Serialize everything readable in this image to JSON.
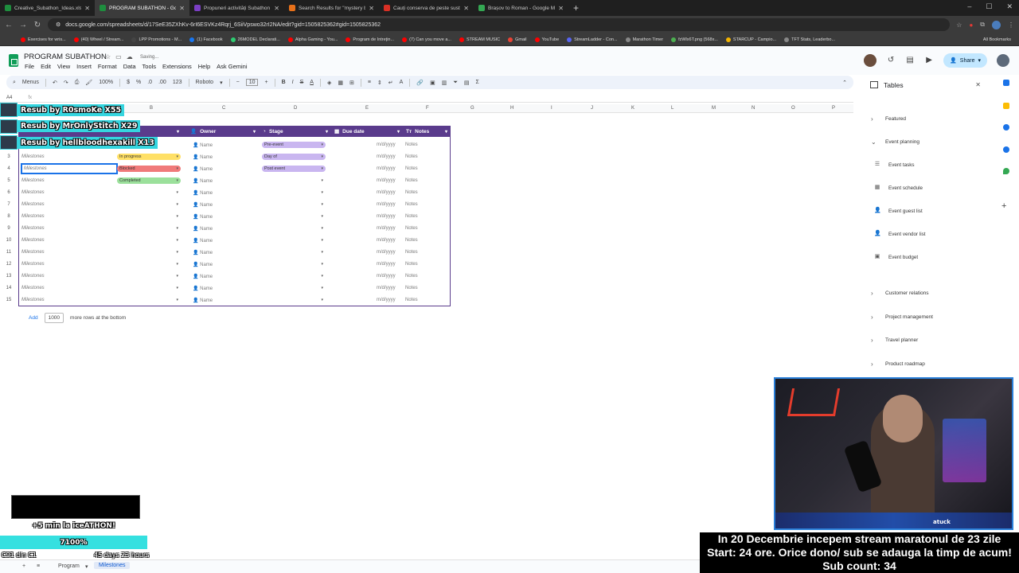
{
  "browser": {
    "tabs": [
      {
        "title": "Creative_Subathon_Ideas.xlsx",
        "color": "#1e8e3e"
      },
      {
        "title": "PROGRAM SUBATHON - Google",
        "color": "#1e8e3e",
        "active": true
      },
      {
        "title": "Propuneri activități Subathon (",
        "color": "#7b3fc4"
      },
      {
        "title": "Search Results for \"mystery b",
        "color": "#e8711a"
      },
      {
        "title": "Cauți conserva de peste sustro",
        "color": "#d93025"
      },
      {
        "title": "Brașov to Roman - Google Ma",
        "color": "#34a853"
      }
    ],
    "url": "docs.google.com/spreadsheets/d/17SeE35ZXhKv-6rI6ESVKz4Rqrj_6SiiVpswo32rI2NA/edit?gid=1505825362#gid=1505825362",
    "bookmarks": [
      {
        "label": "Exercises for wris...",
        "color": "#ff0000"
      },
      {
        "label": "(40) Wheel / Stream...",
        "color": "#ff0000"
      },
      {
        "label": "LPP Promotions - M...",
        "color": "#444444"
      },
      {
        "label": "(1) Facebook",
        "color": "#1877f2"
      },
      {
        "label": "26MODEL Declarati...",
        "color": "#2ecc71"
      },
      {
        "label": "Alpha Gaming - You...",
        "color": "#ff0000"
      },
      {
        "label": "Program de Intreţin...",
        "color": "#ff0000"
      },
      {
        "label": "(7) Can you move a...",
        "color": "#ff0000"
      },
      {
        "label": "STREAM MUSIC",
        "color": "#ff0000"
      },
      {
        "label": "Gmail",
        "color": "#ea4335"
      },
      {
        "label": "YouTube",
        "color": "#ff0000"
      },
      {
        "label": "StreamLadder - Con...",
        "color": "#5865f2"
      },
      {
        "label": "Marathon Timer",
        "color": "#888888"
      },
      {
        "label": "fzWlx6T.png (568x...",
        "color": "#4caf50"
      },
      {
        "label": "STARCUP - Campio...",
        "color": "#f4b400"
      },
      {
        "label": "TFT Stats, Leaderbo...",
        "color": "#888888"
      }
    ],
    "all_bookmarks": "All Bookmarks"
  },
  "sheets": {
    "title": "PROGRAM SUBATHON",
    "status": "Saving...",
    "menu": [
      "File",
      "Edit",
      "View",
      "Insert",
      "Format",
      "Data",
      "Tools",
      "Extensions",
      "Help",
      "Ask Gemini"
    ],
    "share": "Share",
    "toolbar": {
      "menus": "Menus",
      "zoom": "100%",
      "currency": "$",
      "percent": "%",
      "dec_less": ".0",
      "dec_more": ".00",
      "numfmt": "123",
      "font": "Roboto",
      "size": "10"
    },
    "cell_ref": "A4",
    "fx": "fx",
    "columns": [
      "A",
      "B",
      "C",
      "D",
      "E",
      "F",
      "G",
      "H",
      "I",
      "J",
      "K",
      "L",
      "M",
      "N",
      "O",
      "P"
    ],
    "table_headers": {
      "owner": "Owner",
      "stage": "Stage",
      "due": "Due date",
      "notes": "Notes"
    },
    "rows": [
      {
        "num": "3",
        "task": "Milestones",
        "status": "In progress",
        "status_color": "#ffe066",
        "owner": "Name",
        "stage": "Day of",
        "stage_color": "#c9b6f0",
        "due": "m/d/yyyy",
        "notes": "Notes"
      },
      {
        "num": "4",
        "task": "Milestones",
        "status": "Blocked",
        "status_color": "#f07a7a",
        "owner": "Name",
        "stage": "Post event",
        "stage_color": "#c9b6f0",
        "due": "m/d/yyyy",
        "notes": "Notes"
      },
      {
        "num": "5",
        "task": "Milestones",
        "status": "Completed",
        "status_color": "#9be09b",
        "owner": "Name",
        "stage": "",
        "stage_color": "",
        "due": "m/d/yyyy",
        "notes": "Notes"
      },
      {
        "num": "6",
        "task": "Milestones",
        "status": "",
        "status_color": "",
        "owner": "Name",
        "stage": "",
        "stage_color": "",
        "due": "m/d/yyyy",
        "notes": "Notes"
      },
      {
        "num": "7",
        "task": "Milestones",
        "status": "",
        "status_color": "",
        "owner": "Name",
        "stage": "",
        "stage_color": "",
        "due": "m/d/yyyy",
        "notes": "Notes"
      },
      {
        "num": "8",
        "task": "Milestones",
        "status": "",
        "status_color": "",
        "owner": "Name",
        "stage": "",
        "stage_color": "",
        "due": "m/d/yyyy",
        "notes": "Notes"
      },
      {
        "num": "9",
        "task": "Milestones",
        "status": "",
        "status_color": "",
        "owner": "Name",
        "stage": "",
        "stage_color": "",
        "due": "m/d/yyyy",
        "notes": "Notes"
      },
      {
        "num": "10",
        "task": "Milestones",
        "status": "",
        "status_color": "",
        "owner": "Name",
        "stage": "",
        "stage_color": "",
        "due": "m/d/yyyy",
        "notes": "Notes"
      },
      {
        "num": "11",
        "task": "Milestones",
        "status": "",
        "status_color": "",
        "owner": "Name",
        "stage": "",
        "stage_color": "",
        "due": "m/d/yyyy",
        "notes": "Notes"
      },
      {
        "num": "12",
        "task": "Milestones",
        "status": "",
        "status_color": "",
        "owner": "Name",
        "stage": "",
        "stage_color": "",
        "due": "m/d/yyyy",
        "notes": "Notes"
      },
      {
        "num": "13",
        "task": "Milestones",
        "status": "",
        "status_color": "",
        "owner": "Name",
        "stage": "",
        "stage_color": "",
        "due": "m/d/yyyy",
        "notes": "Notes"
      },
      {
        "num": "14",
        "task": "Milestones",
        "status": "",
        "status_color": "",
        "owner": "Name",
        "stage": "",
        "stage_color": "",
        "due": "m/d/yyyy",
        "notes": "Notes"
      },
      {
        "num": "15",
        "task": "Milestones",
        "status": "",
        "status_color": "",
        "owner": "Name",
        "stage": "",
        "stage_color": "",
        "due": "m/d/yyyy",
        "notes": "Notes"
      }
    ],
    "top_stage_chip": "Pre-event",
    "top_owner": "Name",
    "top_due": "m/d/yyyy",
    "top_notes": "Notes",
    "add_label": "Add",
    "add_count": "1000",
    "add_suffix": "more rows at the bottom",
    "sheet_tabs": [
      "Program",
      "Milestones"
    ],
    "accent": "#5a3b8c"
  },
  "side_panel": {
    "title": "Tables",
    "sections": [
      "Featured",
      "Event planning",
      "Customer relations",
      "Project management",
      "Travel planner",
      "Product roadmap"
    ],
    "event_items": [
      {
        "label": "Event tasks",
        "icon": "checklist-icon"
      },
      {
        "label": "Event schedule",
        "icon": "calendar-icon"
      },
      {
        "label": "Event guest list",
        "icon": "person-icon"
      },
      {
        "label": "Event vendor list",
        "icon": "person-icon"
      },
      {
        "label": "Event budget",
        "icon": "money-icon"
      }
    ]
  },
  "overlay": {
    "resubs": [
      "Resub by R0smoKe X55",
      "Resub by MrOnlyStitch X29",
      "Resub by hellbloodhexakill X13"
    ],
    "widget_text": "+5 min la iceATHON!",
    "progress_text": "7100%",
    "progress_fraction": 1.0,
    "bottom_left": "C91 din C1",
    "bottom_right": "45 days 23 hours",
    "webcam_name": "atuck",
    "announcement": [
      "In 20 Decembrie incepem stream maratonul de 23 zile",
      "Start: 24 ore. Orice dono/ sub se adauga la timp de acum!",
      "Sub count: 34"
    ]
  }
}
